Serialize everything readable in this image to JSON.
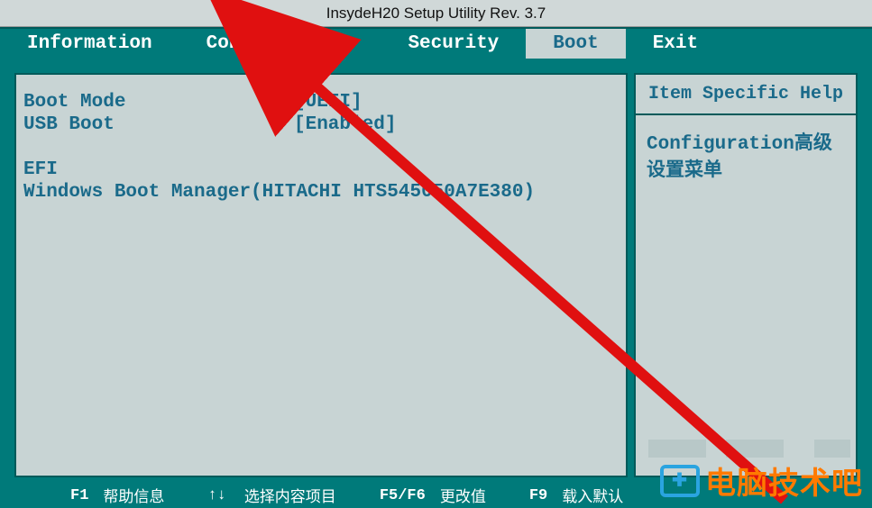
{
  "title": "InsydeH20 Setup Utility Rev. 3.7",
  "tabs": [
    {
      "label": "Information"
    },
    {
      "label": "Configuration"
    },
    {
      "label": "Security"
    },
    {
      "label": "Boot"
    },
    {
      "label": "Exit"
    }
  ],
  "active_tab_index": 3,
  "settings": [
    {
      "label": "Boot Mode",
      "value": "[UEFI]"
    },
    {
      "label": "USB Boot",
      "value": "[Enabled]"
    }
  ],
  "boot_entries": [
    "EFI",
    "Windows Boot Manager(HITACHI HTS545050A7E380)"
  ],
  "help": {
    "header": "Item Specific Help",
    "body": "Configuration高级设置菜单"
  },
  "footer": {
    "f1_key": "F1",
    "f1_label": "帮助信息",
    "arrows": "↑↓",
    "arrows_label": "选择内容项目",
    "f5f6_key": "F5/F6",
    "f5f6_label": "更改值",
    "f9_key": "F9",
    "f9_label": "载入默认"
  },
  "watermark": "电脑技术吧"
}
